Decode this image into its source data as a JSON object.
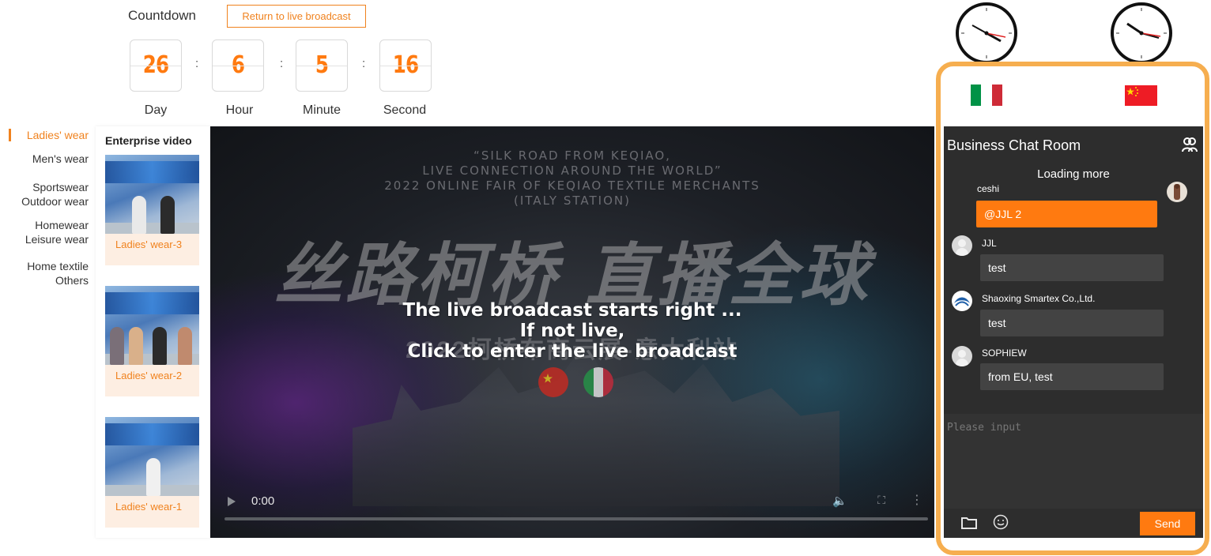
{
  "countdown": {
    "title": "Countdown",
    "return_label": "Return to live broadcast",
    "day": "26",
    "hour": "6",
    "minute": "5",
    "second": "16",
    "separator": ":",
    "day_label": "Day",
    "hour_label": "Hour",
    "minute_label": "Minute",
    "second_label": "Second"
  },
  "categories": [
    "Ladies' wear",
    "Men's wear",
    "Sportswear",
    "Outdoor wear",
    "Homewear",
    "Leisure wear",
    "Home textile",
    "Others"
  ],
  "enterprise": {
    "title": "Enterprise video",
    "videos": [
      {
        "label": "Ladies' wear-3"
      },
      {
        "label": "Ladies' wear-2"
      },
      {
        "label": "Ladies' wear-1"
      }
    ]
  },
  "video": {
    "headline_1": "“SILK ROAD FROM KEQIAO,",
    "headline_2": "LIVE CONNECTION AROUND THE WORLD”",
    "headline_3": "2022 ONLINE FAIR OF KEQIAO TEXTILE MERCHANTS",
    "headline_4": "(ITALY STATION)",
    "calligraphy": "丝路柯桥 直播全球",
    "subtitle": "2022柯桥布商云展-意大利站",
    "message_1": "The live broadcast starts right ...",
    "message_2": "If not live,",
    "message_3": "Click to enter the live broadcast",
    "time": "0:00",
    "progress": 0
  },
  "chat": {
    "title": "Business Chat Room",
    "loading": "Loading more",
    "messages": [
      {
        "name": "ceshi",
        "text": "@JJL 2"
      },
      {
        "name": "JJL",
        "text": "test"
      },
      {
        "name": "Shaoxing Smartex Co.,Ltd.",
        "text": "test"
      },
      {
        "name": "SOPHIEW",
        "text": "from EU, test"
      }
    ],
    "input_placeholder": "Please input",
    "send_label": "Send"
  },
  "colors": {
    "accent": "#ff7a10",
    "frame": "#f6ae4f",
    "chat_bg": "#2d2d2d"
  }
}
